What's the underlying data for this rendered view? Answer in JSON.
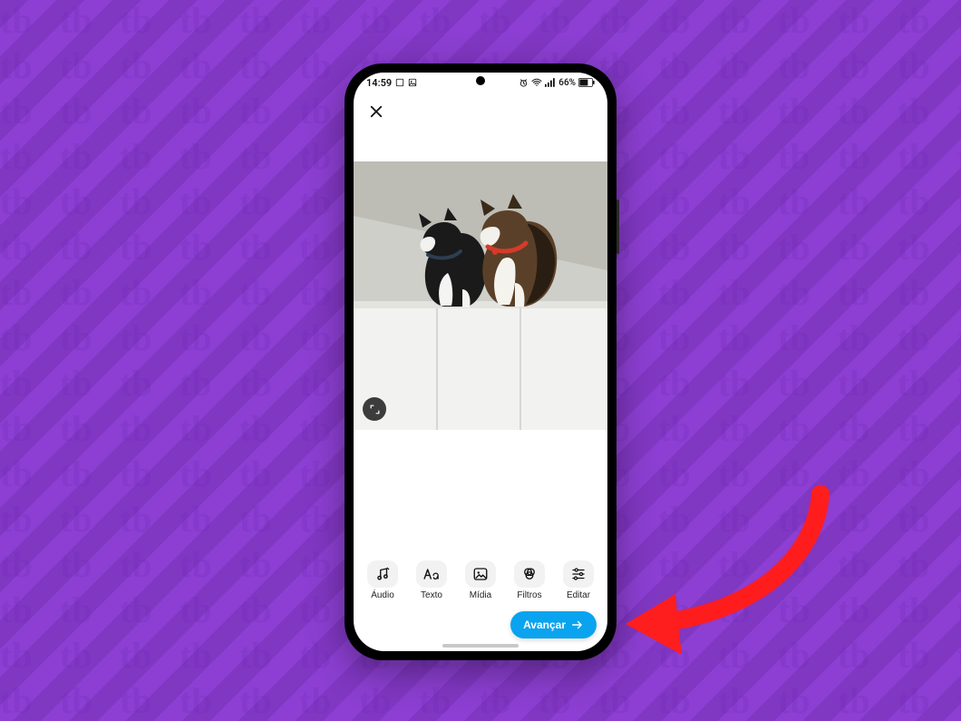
{
  "statusbar": {
    "time": "14:59",
    "battery_text": "66%"
  },
  "tools": {
    "audio": "Áudio",
    "text": "Texto",
    "media": "Mídia",
    "filters": "Filtros",
    "edit": "Editar"
  },
  "buttons": {
    "next": "Avançar"
  },
  "colors": {
    "backdrop": "#8a3bd1",
    "primary": "#0aa3ef",
    "annotation": "#ff1e1e"
  }
}
